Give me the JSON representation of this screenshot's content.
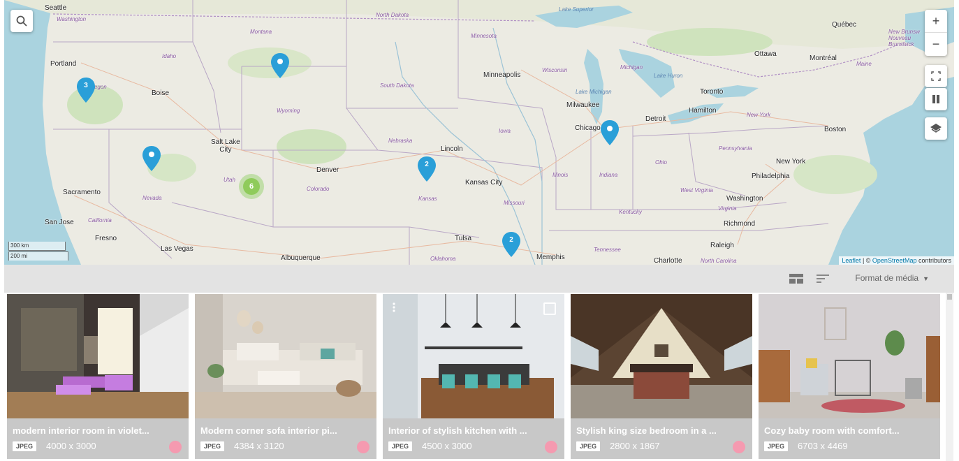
{
  "map": {
    "search_icon": "search-icon",
    "zoom_in_label": "+",
    "zoom_out_label": "−",
    "fullscreen_icon": "fullscreen-icon",
    "pause_icon": "pause-icon",
    "layers_icon": "layers-icon",
    "scale_km": "300 km",
    "scale_mi": "200 mi",
    "attribution_leaflet": "Leaflet",
    "attribution_sep": " | © ",
    "attribution_osm": "OpenStreetMap",
    "attribution_tail": " contributors",
    "cities": [
      {
        "id": "seattle",
        "label": "Seattle"
      },
      {
        "id": "portland",
        "label": "Portland"
      },
      {
        "id": "boise",
        "label": "Boise"
      },
      {
        "id": "salt-lake",
        "label": "Salt Lake\nCity"
      },
      {
        "id": "sacramento",
        "label": "Sacramento"
      },
      {
        "id": "san-jose",
        "label": "San Jose"
      },
      {
        "id": "fresno",
        "label": "Fresno"
      },
      {
        "id": "las-vegas",
        "label": "Las Vegas"
      },
      {
        "id": "albuquerque",
        "label": "Albuquerque"
      },
      {
        "id": "denver",
        "label": "Denver"
      },
      {
        "id": "lincoln",
        "label": "Lincoln"
      },
      {
        "id": "kansas-city",
        "label": "Kansas City"
      },
      {
        "id": "tulsa",
        "label": "Tulsa"
      },
      {
        "id": "memphis",
        "label": "Memphis"
      },
      {
        "id": "minneapolis",
        "label": "Minneapolis"
      },
      {
        "id": "milwaukee",
        "label": "Milwaukee"
      },
      {
        "id": "chicago",
        "label": "Chicago"
      },
      {
        "id": "detroit",
        "label": "Detroit"
      },
      {
        "id": "toronto",
        "label": "Toronto"
      },
      {
        "id": "hamilton",
        "label": "Hamilton"
      },
      {
        "id": "ottawa",
        "label": "Ottawa"
      },
      {
        "id": "montreal",
        "label": "Montréal"
      },
      {
        "id": "quebec",
        "label": "Québec"
      },
      {
        "id": "boston",
        "label": "Boston"
      },
      {
        "id": "new-york",
        "label": "New York"
      },
      {
        "id": "philadelphia",
        "label": "Philadelphia"
      },
      {
        "id": "washington",
        "label": "Washington"
      },
      {
        "id": "richmond",
        "label": "Richmond"
      },
      {
        "id": "raleigh",
        "label": "Raleigh"
      },
      {
        "id": "charlotte",
        "label": "Charlotte"
      }
    ],
    "states": [
      {
        "id": "washington-st",
        "label": "Washington"
      },
      {
        "id": "montana",
        "label": "Montana"
      },
      {
        "id": "north-dakota",
        "label": "North Dakota"
      },
      {
        "id": "minnesota",
        "label": "Minnesota"
      },
      {
        "id": "idaho",
        "label": "Idaho"
      },
      {
        "id": "oregon",
        "label": "Oregon"
      },
      {
        "id": "south-dakota",
        "label": "South Dakota"
      },
      {
        "id": "wisconsin",
        "label": "Wisconsin"
      },
      {
        "id": "michigan",
        "label": "Michigan"
      },
      {
        "id": "wyoming",
        "label": "Wyoming"
      },
      {
        "id": "nebraska",
        "label": "Nebraska"
      },
      {
        "id": "iowa",
        "label": "Iowa"
      },
      {
        "id": "utah",
        "label": "Utah"
      },
      {
        "id": "colorado",
        "label": "Colorado"
      },
      {
        "id": "nevada",
        "label": "Nevada"
      },
      {
        "id": "california",
        "label": "California"
      },
      {
        "id": "kansas",
        "label": "Kansas"
      },
      {
        "id": "missouri",
        "label": "Missouri"
      },
      {
        "id": "illinois",
        "label": "Illinois"
      },
      {
        "id": "indiana",
        "label": "Indiana"
      },
      {
        "id": "ohio",
        "label": "Ohio"
      },
      {
        "id": "pennsylvania",
        "label": "Pennsylvania"
      },
      {
        "id": "new-york-st",
        "label": "New York"
      },
      {
        "id": "west-virginia",
        "label": "West Virginia"
      },
      {
        "id": "virginia",
        "label": "Virginia"
      },
      {
        "id": "kentucky",
        "label": "Kentucky"
      },
      {
        "id": "tennessee",
        "label": "Tennessee"
      },
      {
        "id": "oklahoma",
        "label": "Oklahoma"
      },
      {
        "id": "north-carolina",
        "label": "North Carolina"
      },
      {
        "id": "maine",
        "label": "Maine"
      },
      {
        "id": "new-brunswick",
        "label": "New Brunsw\nNouveau\nBrunswick"
      }
    ],
    "waters": [
      {
        "id": "lake-superior",
        "label": "Lake Superior"
      },
      {
        "id": "lake-michigan",
        "label": "Lake Michigan"
      },
      {
        "id": "lake-huron",
        "label": "Lake Huron"
      }
    ],
    "markers": [
      {
        "id": "oregon-pin",
        "count": "3",
        "type": "pin"
      },
      {
        "id": "montana-pin",
        "count": "",
        "type": "pin"
      },
      {
        "id": "nevada-pin",
        "count": "",
        "type": "pin"
      },
      {
        "id": "utah-cluster",
        "count": "6",
        "type": "cluster"
      },
      {
        "id": "kansas-pin",
        "count": "2",
        "type": "pin"
      },
      {
        "id": "chicago-pin",
        "count": "",
        "type": "pin"
      },
      {
        "id": "arkansas-pin",
        "count": "2",
        "type": "pin"
      }
    ]
  },
  "toolbar": {
    "grid_view_icon": "grid-view-icon",
    "sort_icon": "sort-icon",
    "format_label": "Format de média",
    "caret": "▼"
  },
  "cards": [
    {
      "title": "modern interior room in violet...",
      "format": "JPEG",
      "dims": "4000 x 3000",
      "color": "#f59ab0"
    },
    {
      "title": "Modern corner sofa interior pi...",
      "format": "JPEG",
      "dims": "4384 x 3120",
      "color": "#f59ab0"
    },
    {
      "title": "Interior of stylish kitchen with ...",
      "format": "JPEG",
      "dims": "4500 x 3000",
      "color": "#f59ab0"
    },
    {
      "title": "Stylish king size bedroom in a ...",
      "format": "JPEG",
      "dims": "2800 x 1867",
      "color": "#f59ab0"
    },
    {
      "title": "Cozy baby room with comfort...",
      "format": "JPEG",
      "dims": "6703 x 4469",
      "color": ""
    }
  ],
  "colors": {
    "marker_blue": "#2a9fd8",
    "cluster_green": "#8fcb5b",
    "card_bg": "#c8c8c8",
    "toolbar_bg": "#e3e3e3",
    "label_pink": "#f59ab0"
  }
}
